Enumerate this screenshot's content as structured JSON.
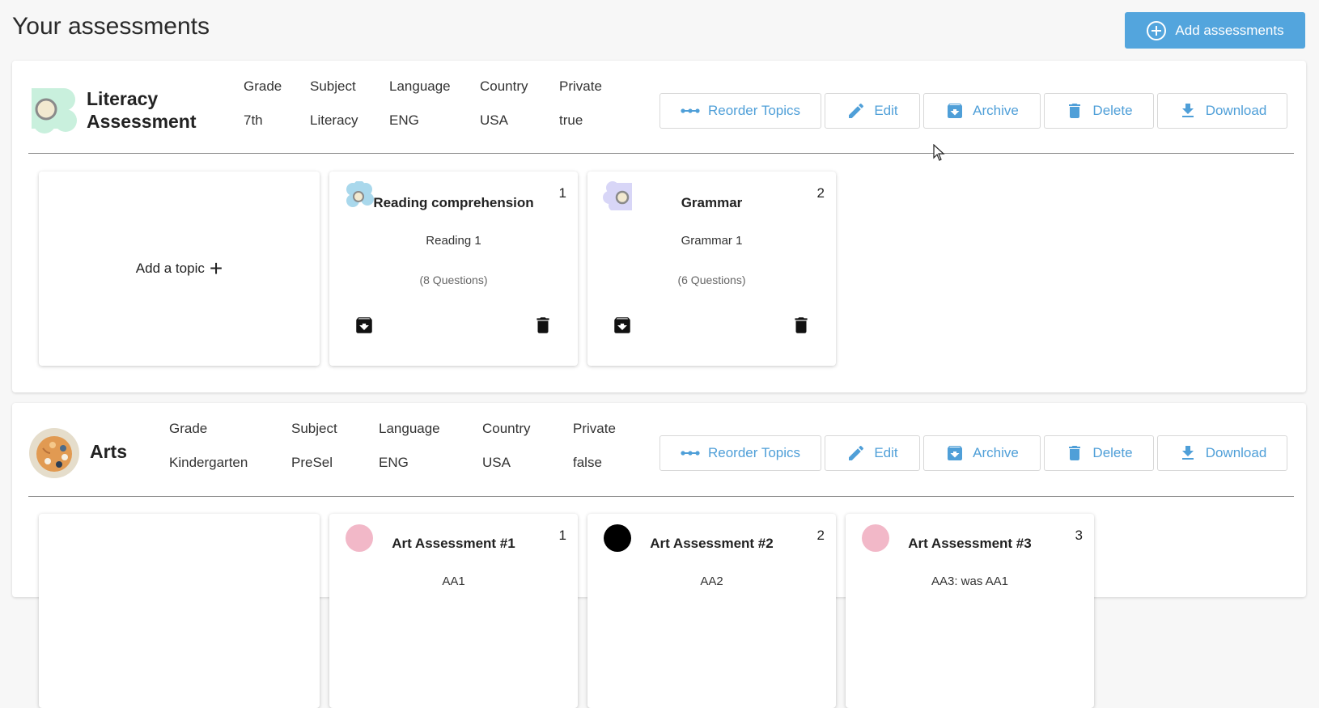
{
  "header": {
    "title": "Your assessments",
    "add_button_label": "Add assessments",
    "accent_color": "#53a5dd"
  },
  "meta_labels": {
    "grade": "Grade",
    "subject": "Subject",
    "language": "Language",
    "country": "Country",
    "private": "Private"
  },
  "action_labels": {
    "reorder": "Reorder Topics",
    "edit": "Edit",
    "archive": "Archive",
    "delete": "Delete",
    "download": "Download"
  },
  "assessments": [
    {
      "name": "Literacy Assessment",
      "icon": "flower-icon",
      "grade": "7th",
      "subject": "Literacy",
      "language": "ENG",
      "country": "USA",
      "private": "true",
      "add_topic_label": "Add a topic",
      "topics": [
        {
          "number": "1",
          "name": "Reading comprehension",
          "subtitle": "Reading 1",
          "questions": "(8 Questions)",
          "icon": "flower-icon",
          "color": "#a9d8ec"
        },
        {
          "number": "2",
          "name": "Grammar",
          "subtitle": "Grammar 1",
          "questions": "(6 Questions)",
          "icon": "flower-icon",
          "color": "#d8d6f7"
        }
      ]
    },
    {
      "name": "Arts",
      "icon": "palette-icon",
      "grade": "Kindergarten",
      "subject": "PreSel",
      "language": "ENG",
      "country": "USA",
      "private": "false",
      "topics": [
        {
          "number": "1",
          "name": "Art Assessment #1",
          "subtitle": "AA1",
          "icon": "circle-icon",
          "color": "#f2b8c8"
        },
        {
          "number": "2",
          "name": "Art Assessment #2",
          "subtitle": "AA2",
          "icon": "circle-icon",
          "color": "#000000"
        },
        {
          "number": "3",
          "name": "Art Assessment #3",
          "subtitle": "AA3: was AA1",
          "icon": "circle-icon",
          "color": "#f2b8c8"
        }
      ]
    }
  ]
}
